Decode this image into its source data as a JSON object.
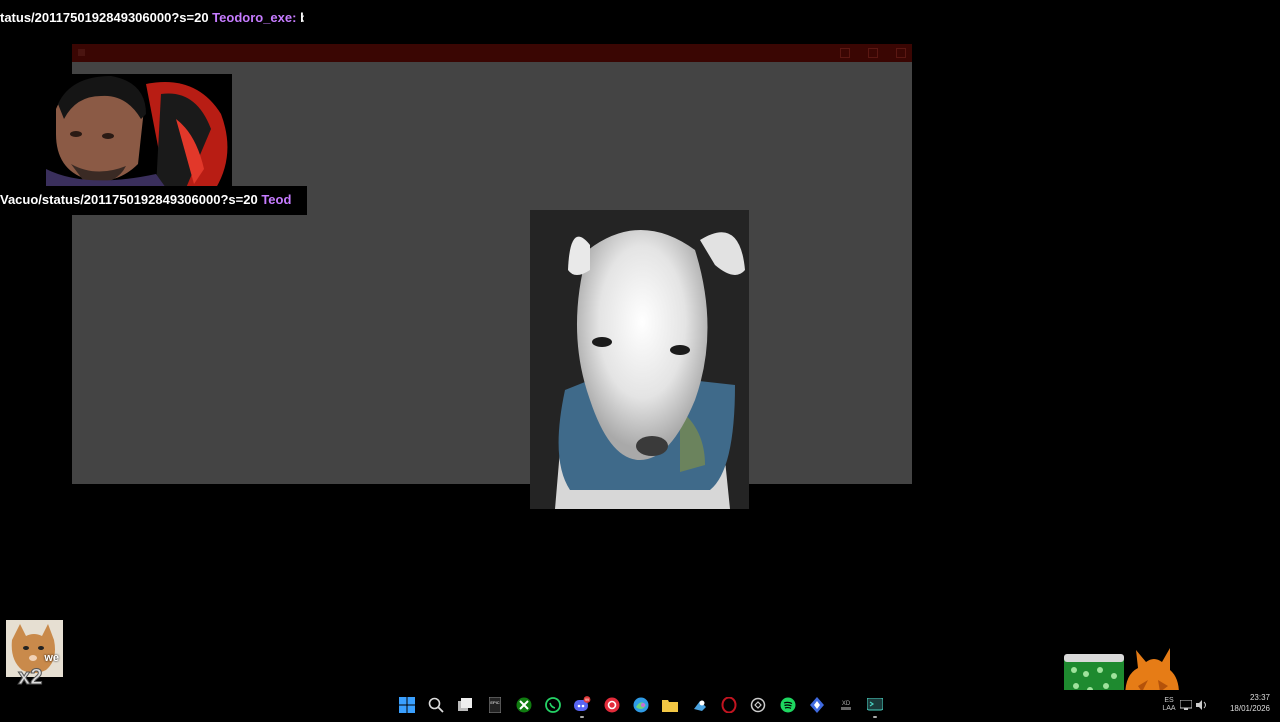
{
  "chat_ticker_top": {
    "text": "tatus/2011750192849306000?s=20",
    "user": "Teodoro_exe:",
    "message": "be"
  },
  "chat_ticker_cam": {
    "text": "Vacuo/status/2011750192849306000?s=20",
    "user": "Teod"
  },
  "sticker": {
    "caption": "we",
    "multiplier": "x2"
  },
  "taskbar": {
    "icons": [
      "windows-start-icon",
      "search-icon",
      "task-view-icon",
      "epic-games-icon",
      "xbox-icon",
      "whatsapp-icon",
      "discord-icon",
      "opera-gx-icon",
      "edge-browser-icon",
      "file-explorer-icon",
      "steam-icon",
      "opera-icon",
      "chatgpt-icon",
      "spotify-icon",
      "blue-app-icon",
      "xd-icon",
      "terminal-icon"
    ],
    "epic_label": "EPIC",
    "xd_label": "XD",
    "discord_badge": "99"
  },
  "tray": {
    "lang_top": "ES",
    "lang_bottom": "LAA",
    "time": "23:37",
    "date": "18/01/2026"
  },
  "colors": {
    "chat_user": "#c67cff",
    "titlebar": "#3a0603",
    "window_bg": "#444444"
  }
}
